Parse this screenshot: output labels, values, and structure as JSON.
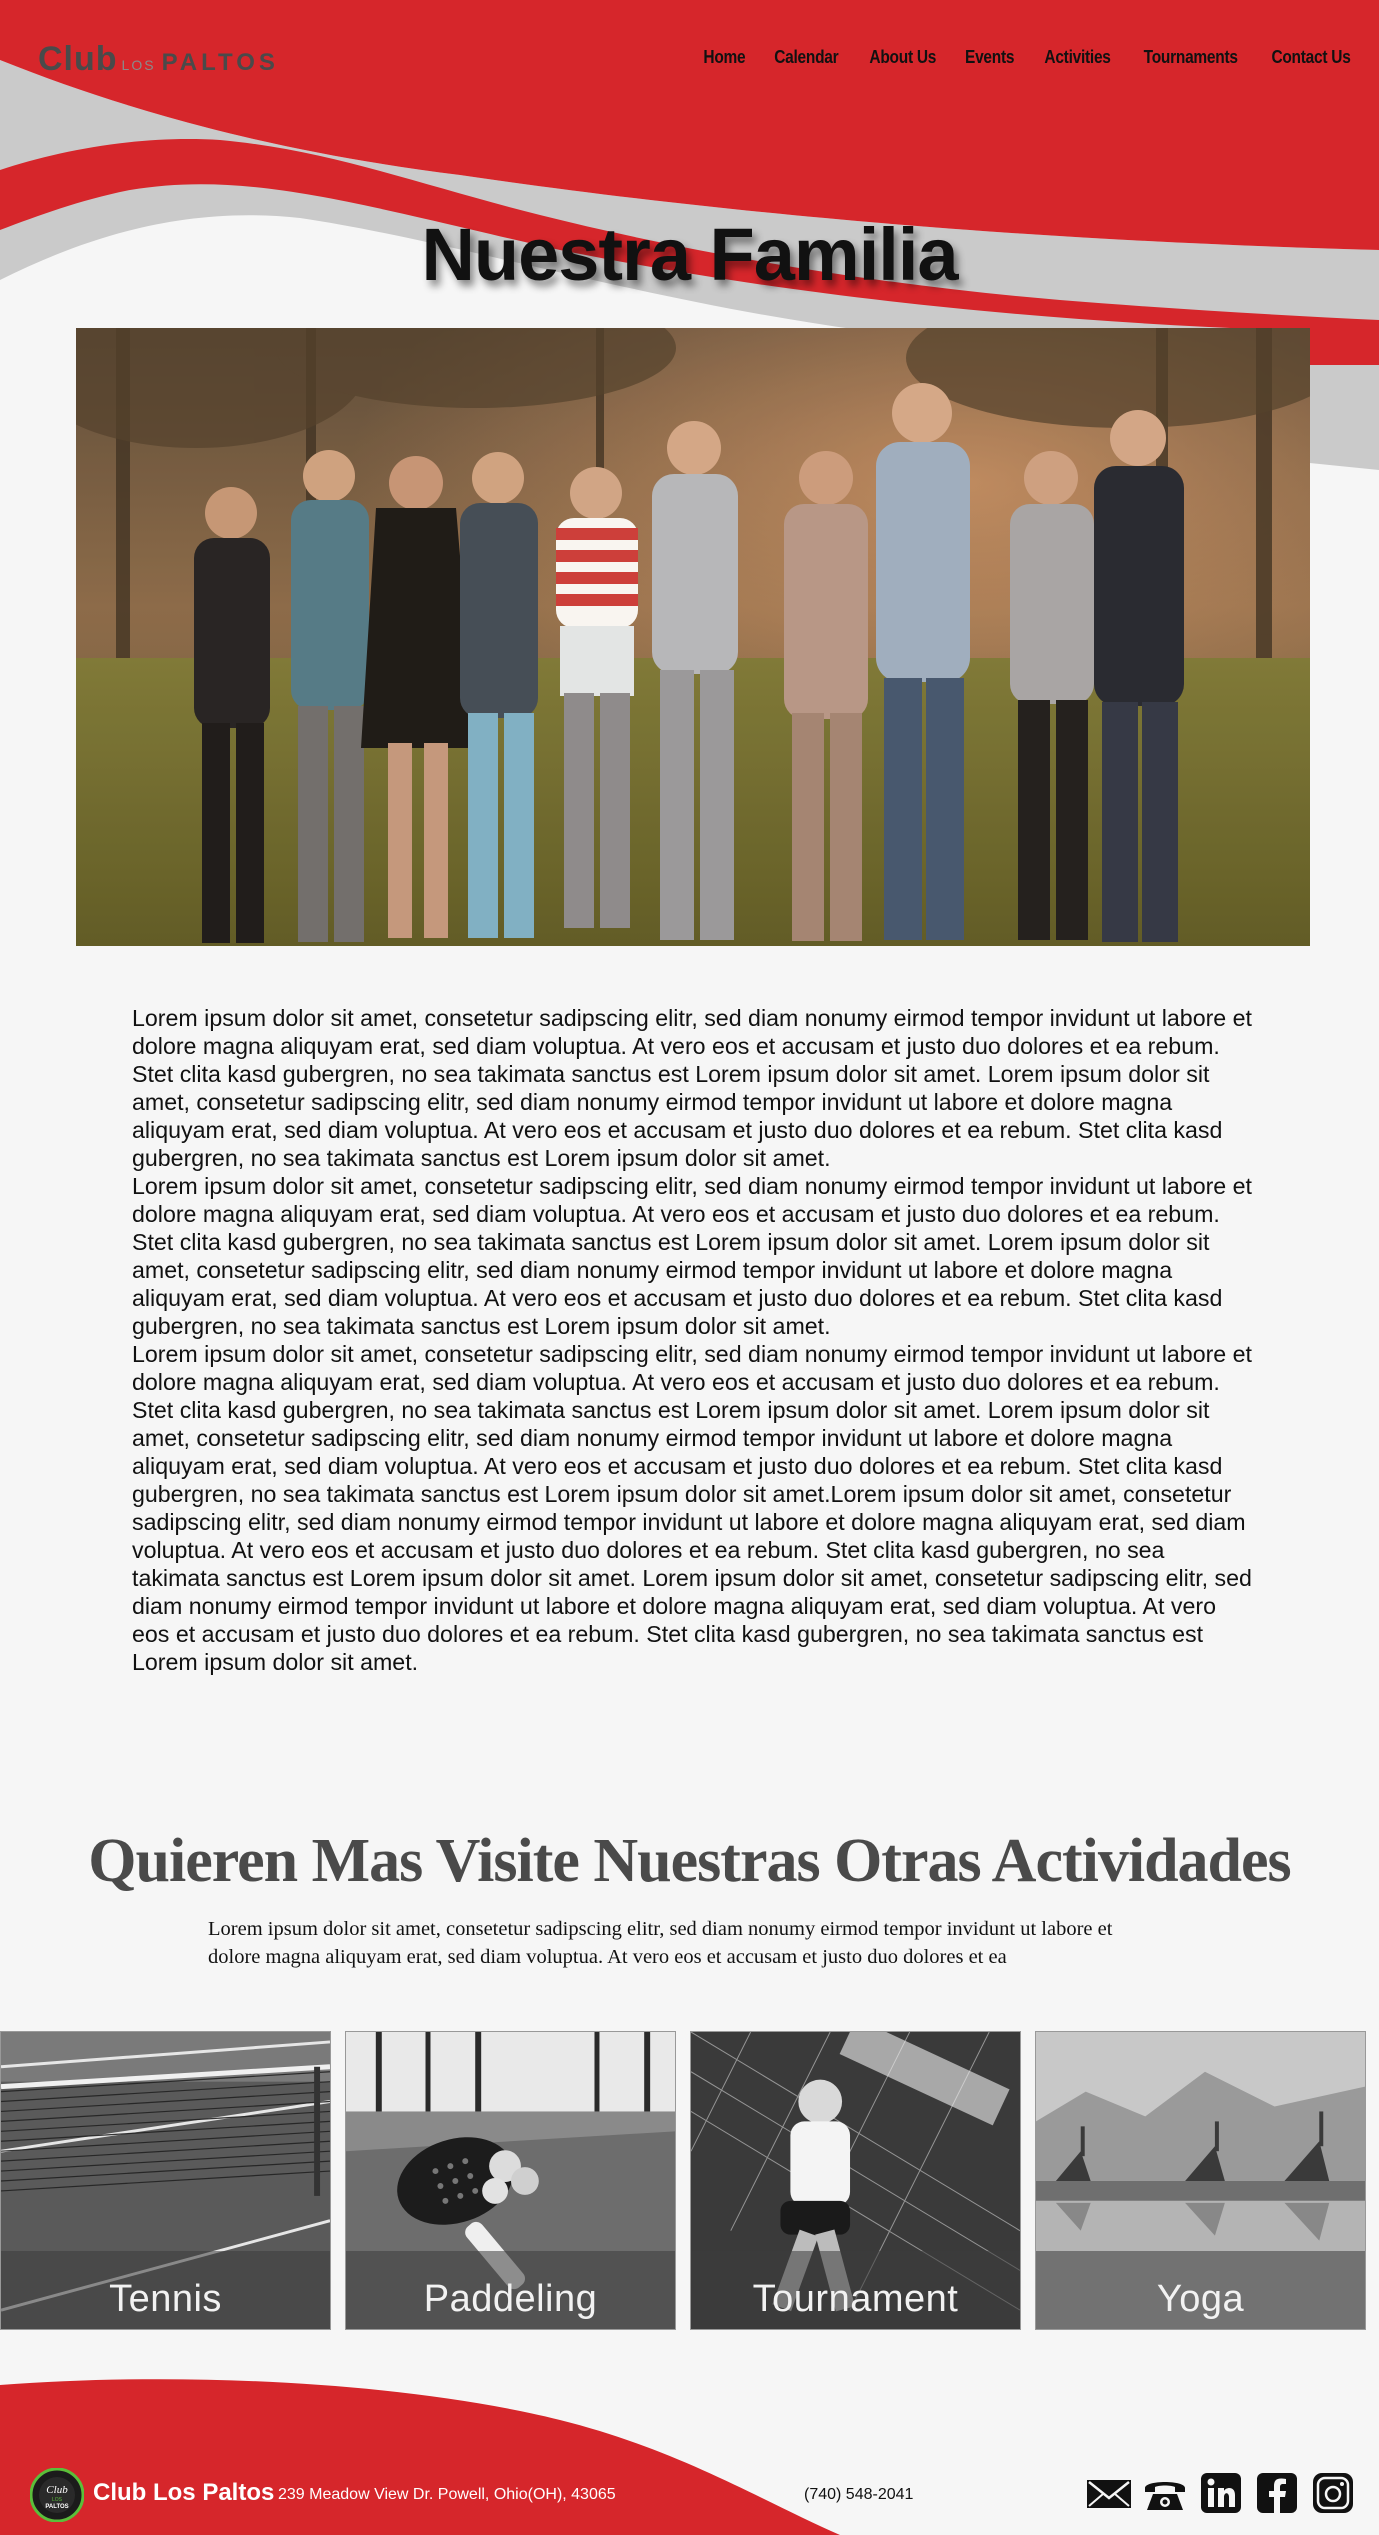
{
  "header": {
    "logo": {
      "club": "Club",
      "los": "LOS",
      "paltos": "PALTOS"
    },
    "nav": [
      "Home",
      "Calendar",
      "About Us",
      "Events",
      "Activities",
      "Tournaments",
      "Contact Us"
    ]
  },
  "hero": {
    "title": "Nuestra Familia"
  },
  "body": {
    "paragraphs": [
      "Lorem ipsum dolor sit amet, consetetur sadipscing elitr, sed diam nonumy eirmod tempor invidunt ut labore et dolore magna aliquyam erat, sed diam voluptua. At vero eos et accusam et justo duo dolores et ea rebum. Stet clita kasd gubergren, no sea takimata sanctus est Lorem ipsum dolor sit amet. Lorem ipsum dolor sit amet, consetetur sadipscing elitr, sed diam nonumy eirmod tempor invidunt ut labore et dolore magna aliquyam erat, sed diam voluptua. At vero eos et accusam et justo duo dolores et ea rebum. Stet clita kasd gubergren, no sea takimata sanctus est Lorem ipsum dolor sit amet.",
      "Lorem ipsum dolor sit amet, consetetur sadipscing elitr, sed diam nonumy eirmod tempor invidunt ut labore et dolore magna aliquyam erat, sed diam voluptua. At vero eos et accusam et justo duo dolores et ea rebum. Stet clita kasd gubergren, no sea takimata sanctus est Lorem ipsum dolor sit amet. Lorem ipsum dolor sit amet, consetetur sadipscing elitr, sed diam nonumy eirmod tempor invidunt ut labore et dolore magna aliquyam erat, sed diam voluptua. At vero eos et accusam et justo duo dolores et ea rebum. Stet clita kasd gubergren, no sea takimata sanctus est Lorem ipsum dolor sit amet.",
      "Lorem ipsum dolor sit amet, consetetur sadipscing elitr, sed diam nonumy eirmod tempor invidunt ut labore et dolore magna aliquyam erat, sed diam voluptua. At vero eos et accusam et justo duo dolores et ea rebum. Stet clita kasd gubergren, no sea takimata sanctus est Lorem ipsum dolor sit amet. Lorem ipsum dolor sit amet, consetetur sadipscing elitr, sed diam nonumy eirmod tempor invidunt ut labore et dolore magna aliquyam erat, sed diam voluptua. At vero eos et accusam et justo duo dolores et ea rebum. Stet clita kasd gubergren, no sea takimata sanctus est Lorem ipsum dolor sit amet.Lorem ipsum dolor sit amet, consetetur sadipscing elitr, sed diam nonumy eirmod tempor invidunt ut labore et dolore magna aliquyam erat, sed diam voluptua. At vero eos et accusam et justo duo dolores et ea rebum. Stet clita kasd gubergren, no sea takimata sanctus est Lorem ipsum dolor sit amet. Lorem ipsum dolor sit amet, consetetur sadipscing elitr, sed diam nonumy eirmod tempor invidunt ut labore et dolore magna aliquyam erat, sed diam voluptua. At vero eos et accusam et justo duo dolores et ea rebum. Stet clita kasd gubergren, no sea takimata sanctus est Lorem ipsum dolor sit amet."
    ]
  },
  "activities": {
    "title": "Quieren Mas Visite Nuestras Otras Actividades",
    "text": "Lorem ipsum dolor sit amet, consetetur sadipscing elitr, sed diam nonumy eirmod tempor invidunt ut labore et dolore magna aliquyam erat, sed diam voluptua. At vero eos et accusam et justo duo dolores et ea",
    "cards": [
      {
        "label": "Tennis"
      },
      {
        "label": "Paddeling"
      },
      {
        "label": "Tournament"
      },
      {
        "label": "Yoga"
      }
    ]
  },
  "footer": {
    "logo_text": {
      "club": "Club",
      "los": "LOS",
      "paltos": "PALTOS"
    },
    "brand": "Club Los Paltos",
    "address": "239 Meadow View Dr. Powell, Ohio(OH), 43065",
    "phone": "(740) 548-2041",
    "social_icons": [
      "mail-icon",
      "phone-icon",
      "linkedin-icon",
      "facebook-icon",
      "instagram-icon"
    ]
  },
  "colors": {
    "brand_red": "#d6262b",
    "wave_gray": "#cacaca",
    "page_bg": "#f6f6f6",
    "text_dark": "#111111",
    "title_gray": "#4a4a4a"
  }
}
